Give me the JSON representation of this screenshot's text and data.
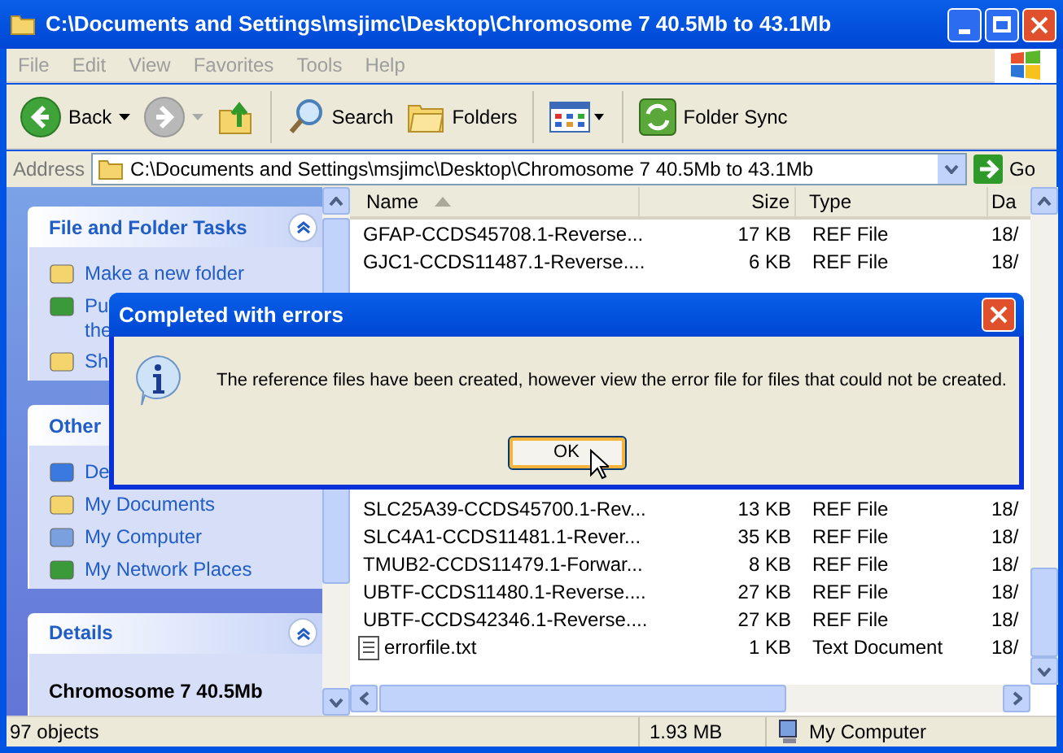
{
  "window": {
    "title": "C:\\Documents and Settings\\msjimc\\Desktop\\Chromosome 7 40.5Mb to 43.1Mb"
  },
  "menu": [
    "File",
    "Edit",
    "View",
    "Favorites",
    "Tools",
    "Help"
  ],
  "toolbar": [
    {
      "kind": "back",
      "label": "Back"
    },
    {
      "kind": "forward"
    },
    {
      "kind": "up"
    },
    {
      "kind": "search",
      "label": "Search"
    },
    {
      "kind": "folders",
      "label": "Folders"
    },
    {
      "kind": "views"
    },
    {
      "kind": "sync",
      "label": "Folder Sync"
    }
  ],
  "address": {
    "label": "Address",
    "value": "C:\\Documents and Settings\\msjimc\\Desktop\\Chromosome 7 40.5Mb to 43.1Mb",
    "go": "Go"
  },
  "sidebar": [
    {
      "title": "File and Folder Tasks",
      "items": [
        "Make a new folder",
        "Pu",
        "the",
        "Sh"
      ]
    },
    {
      "title": "Other",
      "items": [
        "De",
        "My Documents",
        "My Computer",
        "My Network Places"
      ]
    },
    {
      "title": "Details",
      "items": [
        "Chromosome 7 40.5Mb"
      ]
    }
  ],
  "file_list": {
    "columns": [
      "Name",
      "Size",
      "Type",
      "Da"
    ],
    "rows": [
      {
        "kind": "ref",
        "name": "GFAP-CCDS45708.1-Reverse...",
        "size": "17 KB",
        "type": "REF File",
        "date": "18/"
      },
      {
        "kind": "ref",
        "name": "GJC1-CCDS11487.1-Reverse....",
        "size": "6 KB",
        "type": "REF File",
        "date": "18/"
      },
      {
        "kind": "ref",
        "name": "SLC25A39-CCDS45700.1-Rev...",
        "size": "13 KB",
        "type": "REF File",
        "date": "18/"
      },
      {
        "kind": "ref",
        "name": "SLC4A1-CCDS11481.1-Rever...",
        "size": "35 KB",
        "type": "REF File",
        "date": "18/"
      },
      {
        "kind": "ref",
        "name": "TMUB2-CCDS11479.1-Forwar...",
        "size": "8 KB",
        "type": "REF File",
        "date": "18/"
      },
      {
        "kind": "ref",
        "name": "UBTF-CCDS11480.1-Reverse....",
        "size": "27 KB",
        "type": "REF File",
        "date": "18/"
      },
      {
        "kind": "ref",
        "name": "UBTF-CCDS42346.1-Reverse....",
        "size": "27 KB",
        "type": "REF File",
        "date": "18/"
      },
      {
        "kind": "text",
        "name": "errorfile.txt",
        "size": "1 KB",
        "type": "Text Document",
        "date": "18/"
      }
    ]
  },
  "status_bar": {
    "objects": "97 objects",
    "size": "1.93 MB",
    "zone": "My Computer"
  },
  "dialog": {
    "title": "Completed with errors",
    "message": "The reference files have been created, however view the error file for files that could not be created.",
    "button": "OK"
  }
}
